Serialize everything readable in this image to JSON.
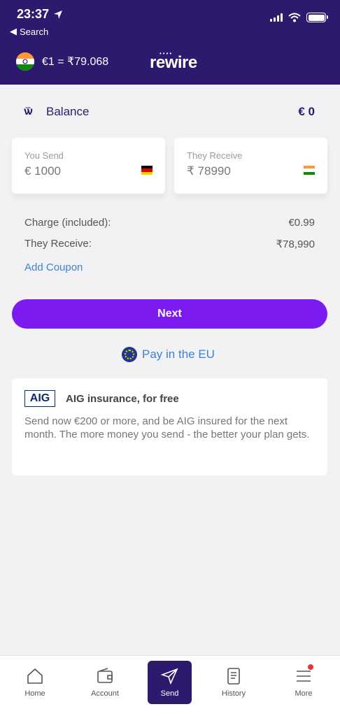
{
  "status": {
    "time": "23:37",
    "back_label": "Search"
  },
  "header": {
    "rate": "€1 = ₹79.068",
    "brand": "rewire"
  },
  "balance": {
    "label": "Balance",
    "value": "€ 0"
  },
  "send_card": {
    "label": "You Send",
    "value": "€ 1000"
  },
  "receive_card": {
    "label": "They Receive",
    "value": "₹ 78990"
  },
  "summary": [
    {
      "label": "Charge (included):",
      "value": "€0.99"
    },
    {
      "label": "They Receive:",
      "value": "₹78,990"
    }
  ],
  "coupon": {
    "label": "Add Coupon"
  },
  "next_button": {
    "label": "Next"
  },
  "pay_eu": {
    "label": "Pay in the EU"
  },
  "aig": {
    "logo": "AIG",
    "title": "AIG insurance, for free",
    "text": "Send now €200 or more, and be AIG insured for the next month. The more money you send - the better your plan gets."
  },
  "tabs": [
    {
      "label": "Home",
      "icon": "home-icon"
    },
    {
      "label": "Account",
      "icon": "wallet-icon"
    },
    {
      "label": "Send",
      "icon": "send-icon"
    },
    {
      "label": "History",
      "icon": "receipt-icon"
    },
    {
      "label": "More",
      "icon": "menu-icon"
    }
  ],
  "colors": {
    "brand_dark": "#2d1a6e",
    "accent": "#7b1bf0",
    "link": "#3b82d6"
  }
}
